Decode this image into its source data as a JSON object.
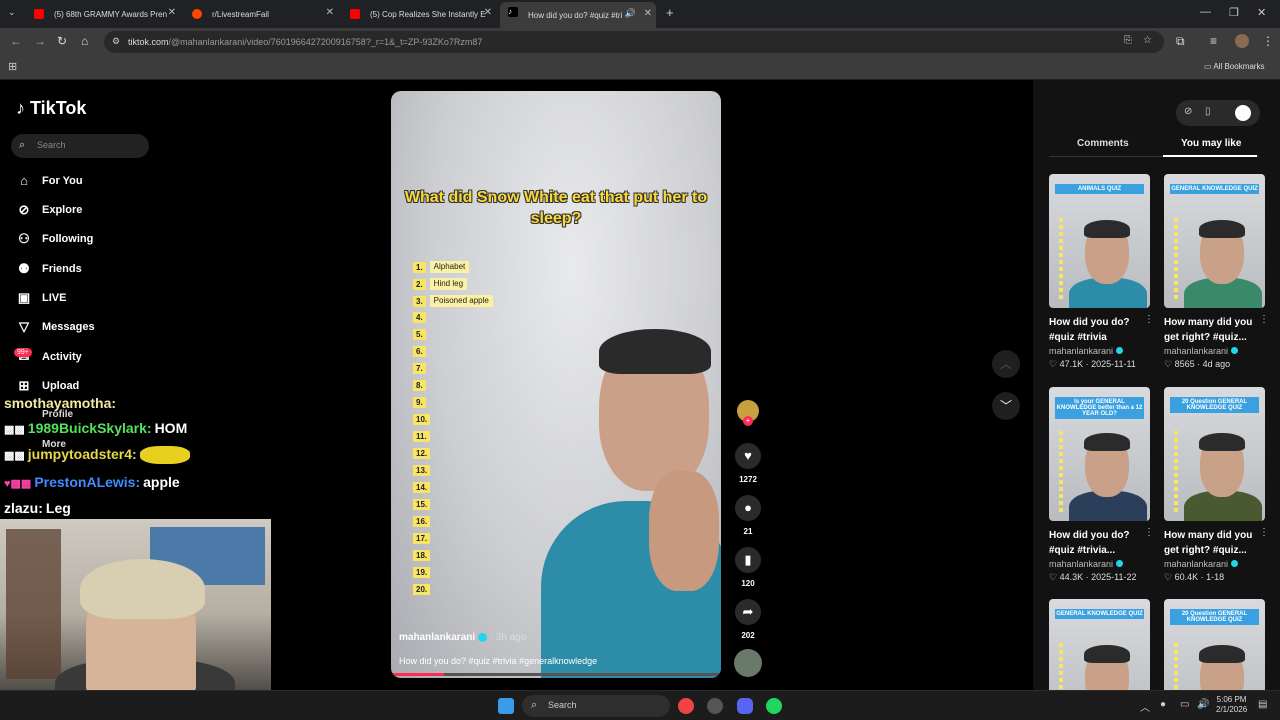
{
  "browser": {
    "tabs": [
      {
        "title": "(5) 68th GRAMMY Awards Pren",
        "color": "#ff0000"
      },
      {
        "title": "r/LivestreamFail",
        "color": "#ff4500"
      },
      {
        "title": "(5) Cop Realizes She Instantly E",
        "color": "#ff0000"
      },
      {
        "title": "How did you do? #quiz #tri",
        "color": "#ffffff"
      }
    ],
    "new_tab": "+",
    "url_domain": "tiktok.com",
    "url_path": "/@mahanlankarani/video/7601966427200916758?_r=1&_t=ZP-93ZKo7Rzm87",
    "bookmarks_label": "All Bookmarks"
  },
  "sidebar": {
    "logo": "TikTok",
    "search_placeholder": "Search",
    "nav": [
      {
        "label": "For You",
        "icon": "⌂"
      },
      {
        "label": "Explore",
        "icon": "⊘"
      },
      {
        "label": "Following",
        "icon": "⚇"
      },
      {
        "label": "Friends",
        "icon": "⚉"
      },
      {
        "label": "LIVE",
        "icon": "▣"
      },
      {
        "label": "Messages",
        "icon": "▽"
      },
      {
        "label": "Activity",
        "icon": "✉"
      },
      {
        "label": "Upload",
        "icon": "⊞"
      }
    ],
    "activity_badge": "99+",
    "hidden_items": [
      "Profile",
      "More"
    ]
  },
  "chat": [
    {
      "user": "smothayamotha:",
      "msg": "",
      "color": "#f3e9a3"
    },
    {
      "user": "1989BuickSkylark:",
      "msg": "HOM",
      "color": "#56e05b"
    },
    {
      "user": "jumpytoadster4:",
      "msg": "",
      "color": "#e4d84a"
    },
    {
      "user": "PrestonALewis:",
      "msg": "apple",
      "color": "#3f8bff"
    },
    {
      "user": "zlazu:",
      "msg": "Leg",
      "color": "#ffffff"
    }
  ],
  "video": {
    "question": "What did Snow White eat that put her to sleep?",
    "answers": [
      "Alphabet",
      "Hind leg",
      "Poisoned apple",
      "",
      "",
      "",
      "",
      "",
      "",
      "",
      "",
      "",
      "",
      "",
      "",
      "",
      "",
      "",
      "",
      ""
    ],
    "author": "mahanlankarani",
    "time_ago": "· 3h ago",
    "description": "How did you do? #quiz #trivia #generalknowledge",
    "progress": 0.16,
    "likes": "1272",
    "comments": "21",
    "saves": "120",
    "shares": "202"
  },
  "right_panel": {
    "tab_comments": "Comments",
    "tab_you_may_like": "You may like",
    "cards": [
      {
        "banner": "ANIMALS QUIZ",
        "title": "How did you do? #quiz #trivia",
        "author": "mahanlankarani",
        "stats": "♡ 47.1K · 2025-11-11"
      },
      {
        "banner": "GENERAL KNOWLEDGE QUIZ",
        "title": "How many did you get right? #quiz...",
        "author": "mahanlankarani",
        "stats": "♡ 8565 · 4d ago"
      },
      {
        "banner": "Is your GENERAL KNOWLEDGE better than a 12 YEAR OLD?",
        "title": "How did you do? #quiz #trivia...",
        "author": "mahanlankarani",
        "stats": "♡ 44.3K · 2025-11-22"
      },
      {
        "banner": "20 Question GENERAL KNOWLEDGE QUIZ",
        "title": "How many did you get right? #quiz...",
        "author": "mahanlankarani",
        "stats": "♡ 60.4K · 1-18"
      },
      {
        "banner": "GENERAL KNOWLEDGE QUIZ",
        "title": "",
        "author": "",
        "stats": ""
      },
      {
        "banner": "20 Question GENERAL KNOWLEDGE QUIZ",
        "title": "",
        "author": "",
        "stats": ""
      }
    ]
  },
  "taskbar": {
    "search_placeholder": "Search",
    "time": "5:06 PM",
    "date": "2/1/2026"
  }
}
